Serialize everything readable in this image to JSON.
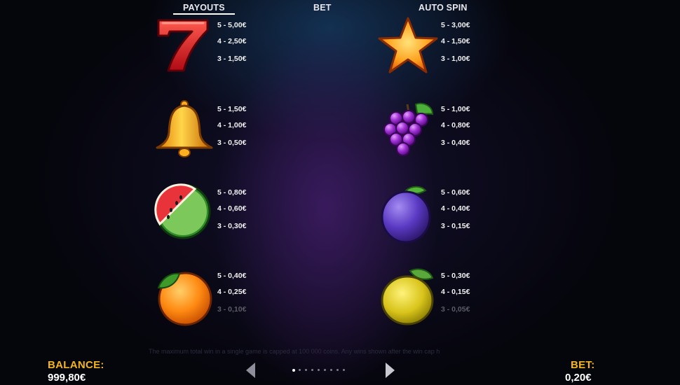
{
  "tabs": [
    {
      "label": "PAYOUTS",
      "active": true
    },
    {
      "label": "BET",
      "active": false
    },
    {
      "label": "AUTO SPIN",
      "active": false
    }
  ],
  "paytable": {
    "seven": {
      "symbol": "seven-icon",
      "pays": [
        "5 - 5,00€",
        "4 - 2,50€",
        "3 - 1,50€"
      ]
    },
    "star": {
      "symbol": "star-icon",
      "pays": [
        "5 - 3,00€",
        "4 - 1,50€",
        "3 - 1,00€"
      ]
    },
    "bell": {
      "symbol": "bell-icon",
      "pays": [
        "5 - 1,50€",
        "4 - 1,00€",
        "3 - 0,50€"
      ]
    },
    "grapes": {
      "symbol": "grapes-icon",
      "pays": [
        "5 - 1,00€",
        "4 - 0,80€",
        "3 - 0,40€"
      ]
    },
    "watermelon": {
      "symbol": "watermelon-icon",
      "pays": [
        "5 - 0,80€",
        "4 - 0,60€",
        "3 - 0,30€"
      ]
    },
    "plum": {
      "symbol": "plum-icon",
      "pays": [
        "5 - 0,60€",
        "4 - 0,40€",
        "3 - 0,15€"
      ]
    },
    "orange": {
      "symbol": "orange-icon",
      "pays": [
        "5 - 0,40€",
        "4 - 0,25€",
        "3 - 0,10€"
      ]
    },
    "lemon": {
      "symbol": "lemon-icon",
      "pays": [
        "5 - 0,30€",
        "4 - 0,15€",
        "3 - 0,05€"
      ]
    }
  },
  "footer": {
    "disclaimer": "The maximum total win in a single game is capped at 100 000 coins. Any wins shown after the win cap h",
    "balance_label": "BALANCE:",
    "balance_value": "999,80€",
    "bet_label": "BET:",
    "bet_value": "0,20€"
  },
  "pagination": {
    "pages": 9,
    "current": 1
  },
  "colors": {
    "accent": "#f5b51c",
    "text": "#ffffff",
    "background": "#05050c"
  }
}
